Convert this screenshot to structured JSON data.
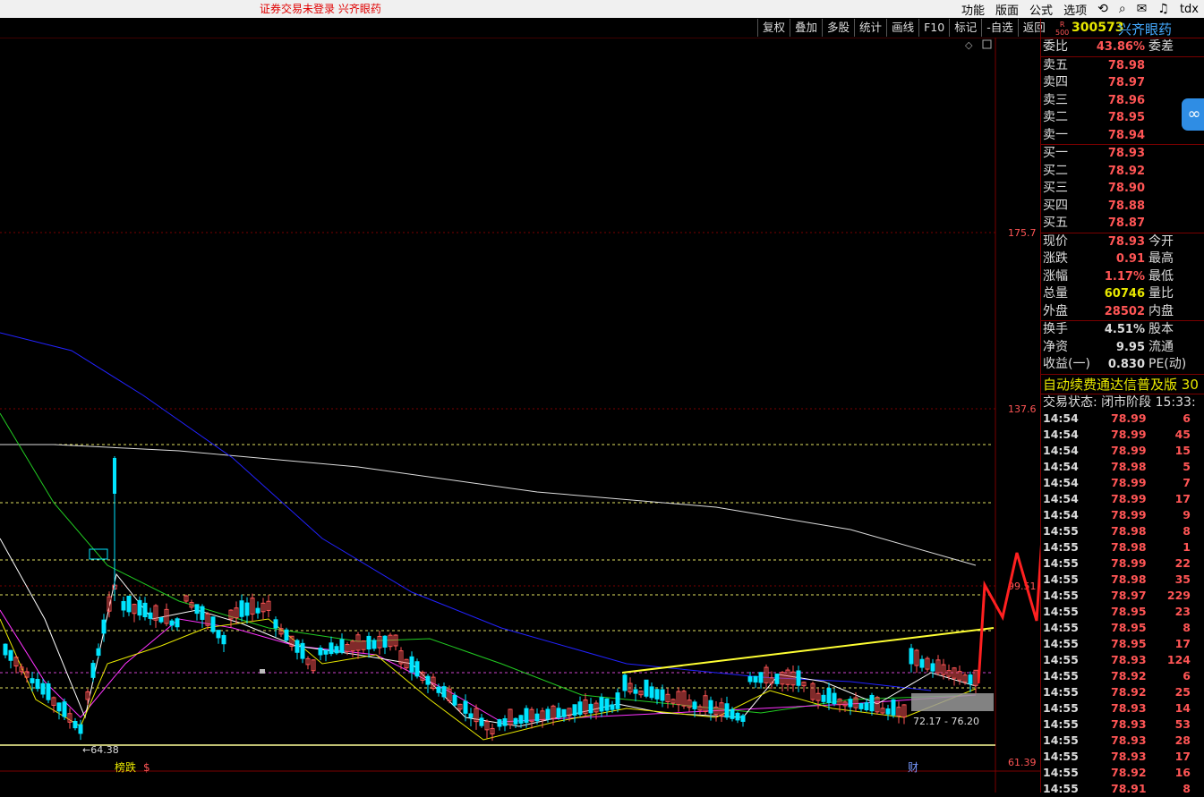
{
  "topbar": {
    "status": "证券交易未登录  兴齐眼药",
    "menu": [
      "功能",
      "版面",
      "公式",
      "选项"
    ],
    "tail": "tdx"
  },
  "toolbar": [
    "复权",
    "叠加",
    "多股",
    "统计",
    "画线",
    "F10",
    "标记",
    "-自选",
    "返回"
  ],
  "chart": {
    "axis_labels": [
      "175.7",
      "137.6",
      "99.51",
      "61.39"
    ],
    "low_label": "←64.38",
    "range_label": "72.17 - 76.20",
    "bottom_tags": [
      "榜跌",
      "$"
    ],
    "bottom_right_tag": "财",
    "colors": {
      "up": "#ff5555",
      "down": "#00e5ff",
      "ma_slow": "#2222ff",
      "ma_white": "#ffffff",
      "ma_green": "#22cc22",
      "ma_magenta": "#ff33ff",
      "trend": "#ffff33"
    }
  },
  "panel": {
    "badge": [
      "R",
      "500"
    ],
    "code": "300573",
    "name": "兴齐眼药",
    "weibi": {
      "label": "委比",
      "value": "43.86%",
      "right": "委差"
    },
    "sells": [
      {
        "label": "卖五",
        "price": "78.98"
      },
      {
        "label": "卖四",
        "price": "78.97"
      },
      {
        "label": "卖三",
        "price": "78.96"
      },
      {
        "label": "卖二",
        "price": "78.95"
      },
      {
        "label": "卖一",
        "price": "78.94"
      }
    ],
    "buys": [
      {
        "label": "买一",
        "price": "78.93"
      },
      {
        "label": "买二",
        "price": "78.92"
      },
      {
        "label": "买三",
        "price": "78.90"
      },
      {
        "label": "买四",
        "price": "78.88"
      },
      {
        "label": "买五",
        "price": "78.87"
      }
    ],
    "stats1": [
      {
        "label": "现价",
        "value": "78.93",
        "right": "今开",
        "cls": ""
      },
      {
        "label": "涨跌",
        "value": "0.91",
        "right": "最高",
        "cls": ""
      },
      {
        "label": "涨幅",
        "value": "1.17%",
        "right": "最低",
        "cls": ""
      },
      {
        "label": "总量",
        "value": "60746",
        "right": "量比",
        "cls": "y"
      },
      {
        "label": "外盘",
        "value": "28502",
        "right": "内盘",
        "cls": ""
      }
    ],
    "stats2": [
      {
        "label": "换手",
        "value": "4.51%",
        "right": "股本",
        "cls": "w"
      },
      {
        "label": "净资",
        "value": "9.95",
        "right": "流通",
        "cls": "w"
      },
      {
        "label": "收益(一)",
        "value": "0.830",
        "right": "PE(动)",
        "cls": "w"
      }
    ],
    "ticker": "自动续费通达信普及版  30",
    "trade_state": "交易状态: 闭市阶段 15:33:",
    "ticks": [
      {
        "t": "14:54",
        "p": "78.99",
        "q": "6"
      },
      {
        "t": "14:54",
        "p": "78.99",
        "q": "45"
      },
      {
        "t": "14:54",
        "p": "78.99",
        "q": "15"
      },
      {
        "t": "14:54",
        "p": "78.98",
        "q": "5"
      },
      {
        "t": "14:54",
        "p": "78.99",
        "q": "7"
      },
      {
        "t": "14:54",
        "p": "78.99",
        "q": "17"
      },
      {
        "t": "14:54",
        "p": "78.99",
        "q": "9"
      },
      {
        "t": "14:55",
        "p": "78.98",
        "q": "8"
      },
      {
        "t": "14:55",
        "p": "78.98",
        "q": "1"
      },
      {
        "t": "14:55",
        "p": "78.99",
        "q": "22"
      },
      {
        "t": "14:55",
        "p": "78.98",
        "q": "35"
      },
      {
        "t": "14:55",
        "p": "78.97",
        "q": "229"
      },
      {
        "t": "14:55",
        "p": "78.95",
        "q": "23"
      },
      {
        "t": "14:55",
        "p": "78.95",
        "q": "8"
      },
      {
        "t": "14:55",
        "p": "78.95",
        "q": "17"
      },
      {
        "t": "14:55",
        "p": "78.93",
        "q": "124"
      },
      {
        "t": "14:55",
        "p": "78.92",
        "q": "6"
      },
      {
        "t": "14:55",
        "p": "78.92",
        "q": "25"
      },
      {
        "t": "14:55",
        "p": "78.93",
        "q": "14"
      },
      {
        "t": "14:55",
        "p": "78.93",
        "q": "53"
      },
      {
        "t": "14:55",
        "p": "78.93",
        "q": "28"
      },
      {
        "t": "14:55",
        "p": "78.93",
        "q": "17"
      },
      {
        "t": "14:55",
        "p": "78.92",
        "q": "16"
      },
      {
        "t": "14:55",
        "p": "78.91",
        "q": "8"
      }
    ]
  }
}
